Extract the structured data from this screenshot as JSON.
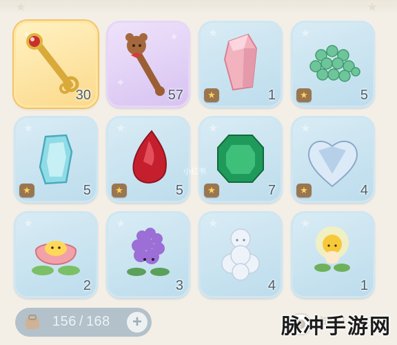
{
  "inventory": {
    "slots": [
      {
        "name": "magic-wand-slot",
        "count": "30",
        "frame": "gold",
        "badge": false
      },
      {
        "name": "brown-bear-wand-slot",
        "count": "57",
        "frame": "purple",
        "badge": false
      },
      {
        "name": "pink-crystal-slot",
        "count": "1",
        "frame": "blue",
        "badge": true
      },
      {
        "name": "green-gem-pile-slot",
        "count": "5",
        "frame": "blue",
        "badge": true
      },
      {
        "name": "cyan-gem-slot",
        "count": "5",
        "frame": "blue",
        "badge": true
      },
      {
        "name": "ruby-drop-slot",
        "count": "5",
        "frame": "blue",
        "badge": true
      },
      {
        "name": "emerald-slot",
        "count": "7",
        "frame": "blue",
        "badge": true
      },
      {
        "name": "diamond-slot",
        "count": "4",
        "frame": "blue",
        "badge": true
      },
      {
        "name": "tulip-sprite-slot",
        "count": "2",
        "frame": "blue",
        "badge": false
      },
      {
        "name": "lilac-sprite-slot",
        "count": "3",
        "frame": "blue",
        "badge": false
      },
      {
        "name": "cloud-fairy-slot",
        "count": "4",
        "frame": "blue",
        "badge": false
      },
      {
        "name": "sun-sprout-slot",
        "count": "1",
        "frame": "blue",
        "badge": false
      }
    ],
    "badge_icon": "star-badge-icon"
  },
  "footer": {
    "capacity_used": "156",
    "capacity_separator": "/",
    "capacity_total": "168",
    "add_label": "+",
    "partial_label": "卢 织 购 马"
  },
  "watermark": "脉冲手游网",
  "faint_mark": "小红书",
  "colors": {
    "slot_blue": "#c6e2f0",
    "slot_gold": "#fbd98a",
    "slot_purple": "#d7c2f1",
    "badge": "#9a7650",
    "count_text": "#4f5e68"
  }
}
